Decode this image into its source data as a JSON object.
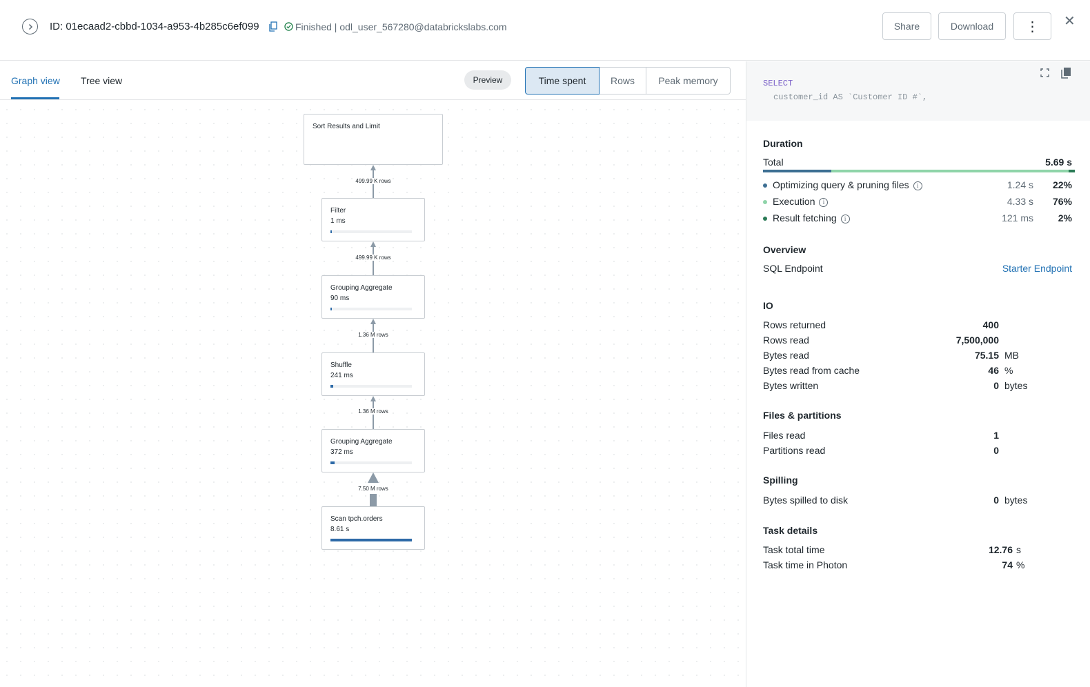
{
  "header": {
    "query_id": "ID: 01ecaad2-cbbd-1034-a953-4b285c6ef099",
    "status": "Finished | odl_user_567280@databrickslabs.com",
    "share_label": "Share",
    "download_label": "Download",
    "more_label": "⋮",
    "close_label": "✕"
  },
  "left": {
    "tabs": [
      "Graph view",
      "Tree view"
    ],
    "preview_label": "Preview",
    "metrics": [
      "Time spent",
      "Rows",
      "Peak memory"
    ]
  },
  "graph": {
    "nodes": [
      {
        "name": "Sort Results and Limit",
        "time": "",
        "fraction": 0
      },
      {
        "name": "Filter",
        "time": "1 ms",
        "fraction": 0.01
      },
      {
        "name": "Grouping Aggregate",
        "time": "90 ms",
        "fraction": 0.01
      },
      {
        "name": "Shuffle",
        "time": "241 ms",
        "fraction": 0.03
      },
      {
        "name": "Grouping Aggregate",
        "time": "372 ms",
        "fraction": 0.05
      },
      {
        "name": "Scan tpch.orders",
        "time": "8.61 s",
        "fraction": 1.0
      }
    ],
    "edges": [
      "499.99 K rows",
      "499.99 K rows",
      "1.36 M rows",
      "1.36 M rows",
      "7.50 M rows"
    ]
  },
  "right": {
    "sql_keyword": "SELECT",
    "sql_line2": "customer_id AS `Customer ID #`,",
    "duration": {
      "title": "Duration",
      "total_label": "Total",
      "total_value": "5.69 s",
      "segments_fraction": [
        0.22,
        0.76,
        0.02
      ],
      "items": [
        {
          "label": "Optimizing query & pruning files",
          "time": "1.24 s",
          "pct": "22%",
          "color": "#3d6f93"
        },
        {
          "label": "Execution",
          "time": "4.33 s",
          "pct": "76%",
          "color": "#8fd4a9"
        },
        {
          "label": "Result fetching",
          "time": "121 ms",
          "pct": "2%",
          "color": "#2a7a55"
        }
      ]
    },
    "overview": {
      "title": "Overview",
      "endpoint_label": "SQL Endpoint",
      "endpoint_value": "Starter Endpoint"
    },
    "io": {
      "title": "IO",
      "rows": [
        {
          "label": "Rows returned",
          "value": "400",
          "unit": ""
        },
        {
          "label": "Rows read",
          "value": "7,500,000",
          "unit": ""
        },
        {
          "label": "Bytes read",
          "value": "75.15",
          "unit": "MB"
        },
        {
          "label": "Bytes read from cache",
          "value": "46",
          "unit": "%"
        },
        {
          "label": "Bytes written",
          "value": "0",
          "unit": "bytes"
        }
      ]
    },
    "files": {
      "title": "Files & partitions",
      "rows": [
        {
          "label": "Files read",
          "value": "1",
          "unit": ""
        },
        {
          "label": "Partitions read",
          "value": "0",
          "unit": ""
        }
      ]
    },
    "spilling": {
      "title": "Spilling",
      "rows": [
        {
          "label": "Bytes spilled to disk",
          "value": "0",
          "unit": "bytes"
        }
      ]
    },
    "task": {
      "title": "Task details",
      "rows": [
        {
          "label": "Task total time",
          "value": "12.76",
          "unit": "s"
        },
        {
          "label": "Task time in Photon",
          "value": "74",
          "unit": "%"
        }
      ]
    }
  }
}
